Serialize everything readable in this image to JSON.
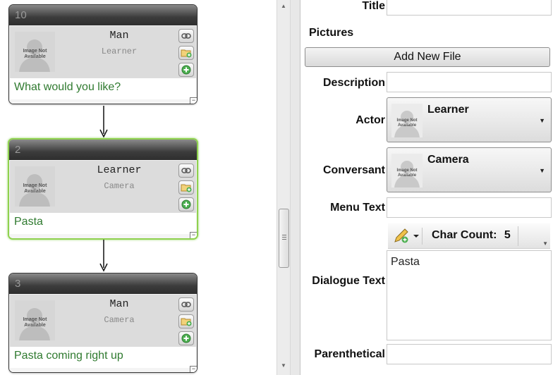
{
  "nodes": [
    {
      "id": "10",
      "actor": "Man",
      "conversant": "Learner",
      "text": "What would you like?",
      "selected": false
    },
    {
      "id": "2",
      "actor": "Learner",
      "conversant": "Camera",
      "text": "Pasta",
      "selected": true
    },
    {
      "id": "3",
      "actor": "Man",
      "conversant": "Camera",
      "text": "Pasta coming right up",
      "selected": false
    }
  ],
  "image_placeholder": "Image Not Available",
  "collapse_glyph": "−",
  "props": {
    "title_label": "Title",
    "title_value": "",
    "pictures_label": "Pictures",
    "add_file_label": "Add New File",
    "description_label": "Description",
    "description_value": "",
    "actor_label": "Actor",
    "actor_value": "Learner",
    "conversant_label": "Conversant",
    "conversant_value": "Camera",
    "menu_text_label": "Menu Text",
    "menu_text_value": "",
    "char_count_label": "Char Count:",
    "char_count_value": "5",
    "dialogue_text_label": "Dialogue Text",
    "dialogue_text_value": "Pasta",
    "parenthetical_label": "Parenthetical",
    "parenthetical_value": ""
  },
  "colors": {
    "selected_border": "#8fd14f",
    "dialogue_text": "#2f7a2f",
    "header_dark": "#2e2e2e"
  },
  "icons": [
    "link-icon",
    "folder-add-icon",
    "add-icon",
    "edit-pencil-icon",
    "chevron-down-icon"
  ]
}
